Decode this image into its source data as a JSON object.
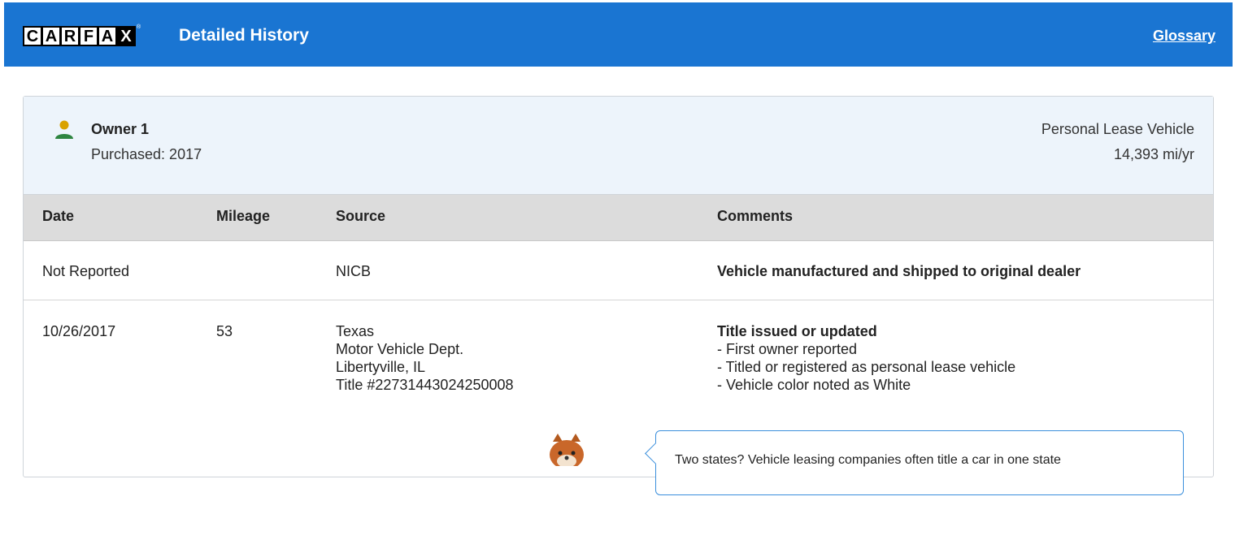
{
  "header": {
    "logo_letters": [
      "C",
      "A",
      "R",
      "F",
      "A",
      "X"
    ],
    "title": "Detailed History",
    "glossary_link": "Glossary",
    "bg_color": "#1a75d2"
  },
  "owner": {
    "icon": "person-icon",
    "name": "Owner 1",
    "purchased": "Purchased: 2017",
    "type": "Personal Lease Vehicle",
    "mileage_per_year": "14,393 mi/yr"
  },
  "table": {
    "columns": {
      "date": "Date",
      "mileage": "Mileage",
      "source": "Source",
      "comments": "Comments"
    },
    "rows": [
      {
        "date": "Not Reported",
        "mileage": "",
        "source": [
          "NICB"
        ],
        "comment_title": "Vehicle manufactured and shipped to original dealer",
        "comment_items": []
      },
      {
        "date": "10/26/2017",
        "mileage": "53",
        "source": [
          "Texas",
          "Motor Vehicle Dept.",
          "Libertyville, IL",
          "Title #22731443024250008"
        ],
        "comment_title": "Title issued or updated",
        "comment_items": [
          "- First owner reported",
          "- Titled or registered as personal lease vehicle",
          "- Vehicle color noted as White"
        ]
      }
    ]
  },
  "tip": {
    "mascot": "fox-mascot",
    "text": "Two states? Vehicle leasing companies often title a car in one state"
  }
}
